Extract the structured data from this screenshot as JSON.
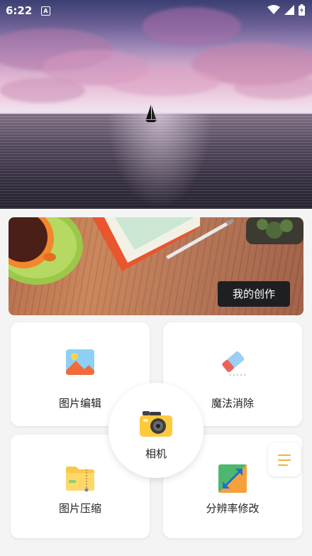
{
  "status_bar": {
    "time": "6:22",
    "notification_icon": "A"
  },
  "banner": {
    "button_label": "我的创作"
  },
  "cards": [
    {
      "label": "图片编辑",
      "icon": "image-edit-icon"
    },
    {
      "label": "魔法消除",
      "icon": "eraser-icon"
    },
    {
      "label": "图片压缩",
      "icon": "compress-folder-icon"
    },
    {
      "label": "分辨率修改",
      "icon": "resolution-resize-icon"
    }
  ],
  "center_action": {
    "label": "相机",
    "icon": "camera-icon"
  },
  "colors": {
    "accent": "#f0b43a",
    "banner_button": "#1e1f22",
    "background": "#f4f4f5"
  }
}
